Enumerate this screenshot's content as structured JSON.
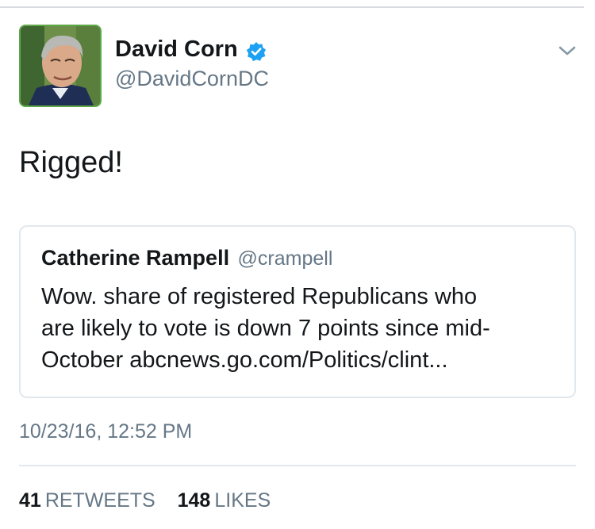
{
  "tweet": {
    "author_name": "David Corn",
    "author_handle": "@DavidCornDC",
    "verified": true,
    "text": "Rigged!",
    "timestamp": "10/23/16, 12:52 PM",
    "stats": {
      "retweets_count": "41",
      "retweets_label": "RETWEETS",
      "likes_count": "148",
      "likes_label": "LIKES"
    }
  },
  "quoted_tweet": {
    "author_name": "Catherine Rampell",
    "author_handle": "@crampell",
    "lines": [
      "Wow. share of registered Republicans who",
      "are likely to vote is down 7 points since mid-",
      "October abcnews.go.com/Politics/clint..."
    ]
  },
  "colors": {
    "text_primary": "#14171a",
    "text_secondary": "#657786",
    "verified_blue": "#1da1f2",
    "border": "#e1e8ed"
  },
  "icons": {
    "verified": "verified-badge-icon",
    "menu": "chevron-down-icon"
  }
}
